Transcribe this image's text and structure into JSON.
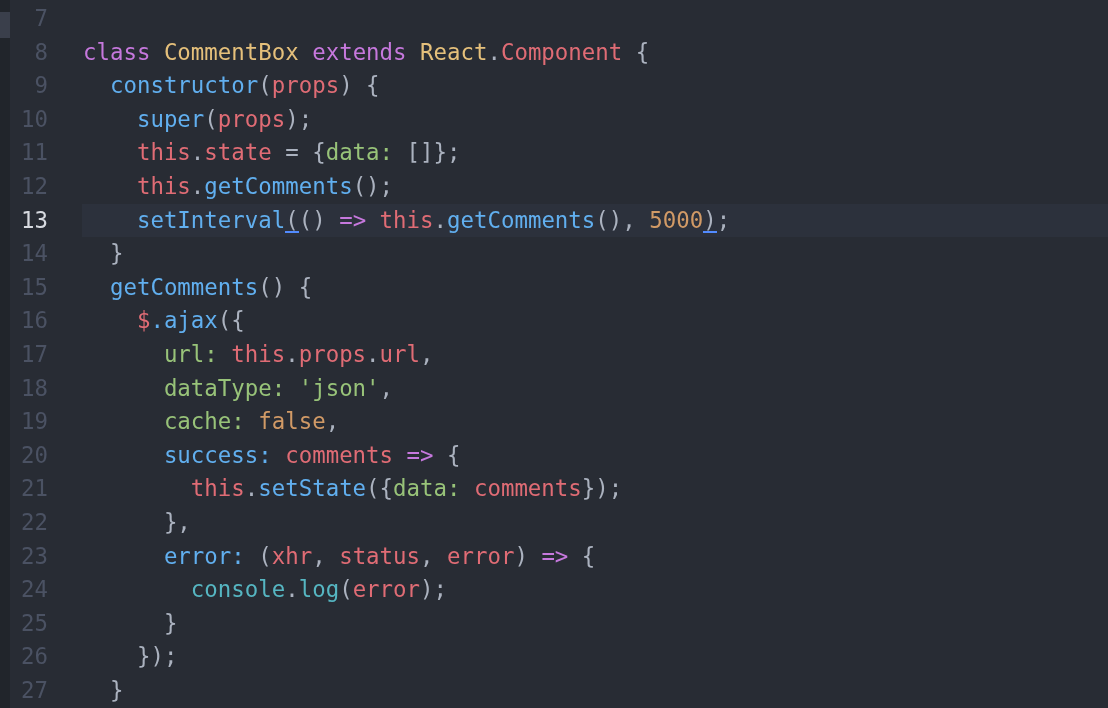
{
  "editor": {
    "lines": [
      {
        "number": "7",
        "current": false
      },
      {
        "number": "8",
        "current": false,
        "tokens": [
          {
            "text": "class ",
            "kind": "keyword"
          },
          {
            "text": "CommentBox ",
            "kind": "class"
          },
          {
            "text": "extends ",
            "kind": "keyword"
          },
          {
            "text": "React",
            "kind": "class"
          },
          {
            "text": ".",
            "kind": "punct"
          },
          {
            "text": "Component",
            "kind": "variable"
          },
          {
            "text": " {",
            "kind": "punct"
          }
        ]
      },
      {
        "number": "9",
        "current": false,
        "tokens": [
          {
            "text": "  constructor",
            "kind": "function"
          },
          {
            "text": "(",
            "kind": "punct"
          },
          {
            "text": "props",
            "kind": "variable"
          },
          {
            "text": ") {",
            "kind": "punct"
          }
        ]
      },
      {
        "number": "10",
        "current": false,
        "tokens": [
          {
            "text": "    super",
            "kind": "function"
          },
          {
            "text": "(",
            "kind": "punct"
          },
          {
            "text": "props",
            "kind": "variable"
          },
          {
            "text": ");",
            "kind": "punct"
          }
        ]
      },
      {
        "number": "11",
        "current": false,
        "tokens": [
          {
            "text": "    this",
            "kind": "variable"
          },
          {
            "text": ".",
            "kind": "punct"
          },
          {
            "text": "state",
            "kind": "variable"
          },
          {
            "text": " = {",
            "kind": "punct"
          },
          {
            "text": "data:",
            "kind": "key"
          },
          {
            "text": " []};",
            "kind": "punct"
          }
        ]
      },
      {
        "number": "12",
        "current": false,
        "tokens": [
          {
            "text": "    this",
            "kind": "variable"
          },
          {
            "text": ".",
            "kind": "punct"
          },
          {
            "text": "getComments",
            "kind": "function"
          },
          {
            "text": "();",
            "kind": "punct"
          }
        ]
      },
      {
        "number": "13",
        "current": true,
        "tokens": [
          {
            "text": "    setInterval",
            "kind": "function"
          },
          {
            "text": "(",
            "kind": "punct",
            "matched": true
          },
          {
            "text": "() ",
            "kind": "punct"
          },
          {
            "text": "=> ",
            "kind": "keyword"
          },
          {
            "text": "this",
            "kind": "variable"
          },
          {
            "text": ".",
            "kind": "punct"
          },
          {
            "text": "getComments",
            "kind": "function"
          },
          {
            "text": "(), ",
            "kind": "punct"
          },
          {
            "text": "5000",
            "kind": "number"
          },
          {
            "text": ")",
            "kind": "punct",
            "matched": true
          },
          {
            "text": ";",
            "kind": "punct"
          }
        ]
      },
      {
        "number": "14",
        "current": false,
        "tokens": [
          {
            "text": "  }",
            "kind": "punct"
          }
        ]
      },
      {
        "number": "15",
        "current": false,
        "tokens": [
          {
            "text": "  getComments",
            "kind": "function"
          },
          {
            "text": "() {",
            "kind": "punct"
          }
        ]
      },
      {
        "number": "16",
        "current": false,
        "tokens": [
          {
            "text": "    $",
            "kind": "variable"
          },
          {
            "text": ".ajax",
            "kind": "function"
          },
          {
            "text": "({",
            "kind": "punct"
          }
        ]
      },
      {
        "number": "17",
        "current": false,
        "tokens": [
          {
            "text": "      url: ",
            "kind": "key"
          },
          {
            "text": "this",
            "kind": "variable"
          },
          {
            "text": ".",
            "kind": "punct"
          },
          {
            "text": "props",
            "kind": "variable"
          },
          {
            "text": ".",
            "kind": "punct"
          },
          {
            "text": "url",
            "kind": "variable"
          },
          {
            "text": ",",
            "kind": "punct"
          }
        ]
      },
      {
        "number": "18",
        "current": false,
        "tokens": [
          {
            "text": "      dataType: ",
            "kind": "key"
          },
          {
            "text": "'json'",
            "kind": "string"
          },
          {
            "text": ",",
            "kind": "punct"
          }
        ]
      },
      {
        "number": "19",
        "current": false,
        "tokens": [
          {
            "text": "      cache: ",
            "kind": "key"
          },
          {
            "text": "false",
            "kind": "number"
          },
          {
            "text": ",",
            "kind": "punct"
          }
        ]
      },
      {
        "number": "20",
        "current": false,
        "tokens": [
          {
            "text": "      success: ",
            "kind": "function"
          },
          {
            "text": "comments ",
            "kind": "variable"
          },
          {
            "text": "=>",
            "kind": "keyword"
          },
          {
            "text": " {",
            "kind": "punct"
          }
        ]
      },
      {
        "number": "21",
        "current": false,
        "tokens": [
          {
            "text": "        this",
            "kind": "variable"
          },
          {
            "text": ".",
            "kind": "punct"
          },
          {
            "text": "setState",
            "kind": "function"
          },
          {
            "text": "({",
            "kind": "punct"
          },
          {
            "text": "data: ",
            "kind": "key"
          },
          {
            "text": "comments",
            "kind": "variable"
          },
          {
            "text": "});",
            "kind": "punct"
          }
        ]
      },
      {
        "number": "22",
        "current": false,
        "tokens": [
          {
            "text": "      },",
            "kind": "punct"
          }
        ]
      },
      {
        "number": "23",
        "current": false,
        "tokens": [
          {
            "text": "      error:",
            "kind": "function"
          },
          {
            "text": " (",
            "kind": "punct"
          },
          {
            "text": "xhr",
            "kind": "variable"
          },
          {
            "text": ", ",
            "kind": "punct"
          },
          {
            "text": "status",
            "kind": "variable"
          },
          {
            "text": ", ",
            "kind": "punct"
          },
          {
            "text": "error",
            "kind": "variable"
          },
          {
            "text": ") ",
            "kind": "punct"
          },
          {
            "text": "=>",
            "kind": "keyword"
          },
          {
            "text": " {",
            "kind": "punct"
          }
        ]
      },
      {
        "number": "24",
        "current": false,
        "tokens": [
          {
            "text": "        console",
            "kind": "builtin"
          },
          {
            "text": ".",
            "kind": "punct"
          },
          {
            "text": "log",
            "kind": "builtin"
          },
          {
            "text": "(",
            "kind": "punct"
          },
          {
            "text": "error",
            "kind": "variable"
          },
          {
            "text": ");",
            "kind": "punct"
          }
        ]
      },
      {
        "number": "25",
        "current": false,
        "tokens": [
          {
            "text": "      }",
            "kind": "punct"
          }
        ]
      },
      {
        "number": "26",
        "current": false,
        "tokens": [
          {
            "text": "    });",
            "kind": "punct"
          }
        ]
      },
      {
        "number": "27",
        "current": false,
        "tokens": [
          {
            "text": "  }",
            "kind": "punct"
          }
        ]
      }
    ]
  }
}
